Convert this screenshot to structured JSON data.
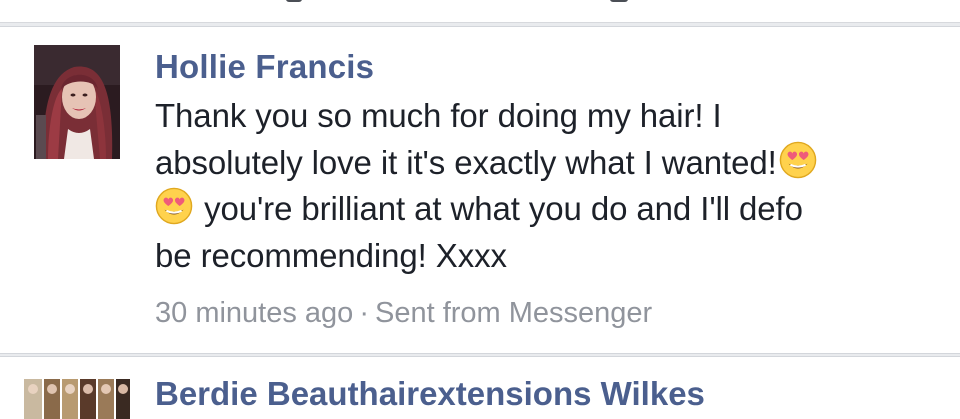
{
  "message": {
    "sender": "Hollie Francis",
    "lines": [
      "Thank you so much for doing my hair! I",
      "absolutely love it it's exactly what I wanted!",
      "you're brilliant at what you do and I'll defo",
      "be recommending! Xxxx"
    ],
    "time": "30 minutes ago",
    "separator": "·",
    "source": "Sent from Messenger"
  },
  "next_message": {
    "sender": "Berdie Beauthairextensions Wilkes"
  },
  "icons": {
    "emoji": "heart-eyes-emoji-icon"
  },
  "colors": {
    "name": "#4b5f8e",
    "text": "#1d2129",
    "meta": "#90949c",
    "background": "#e9ebee"
  }
}
